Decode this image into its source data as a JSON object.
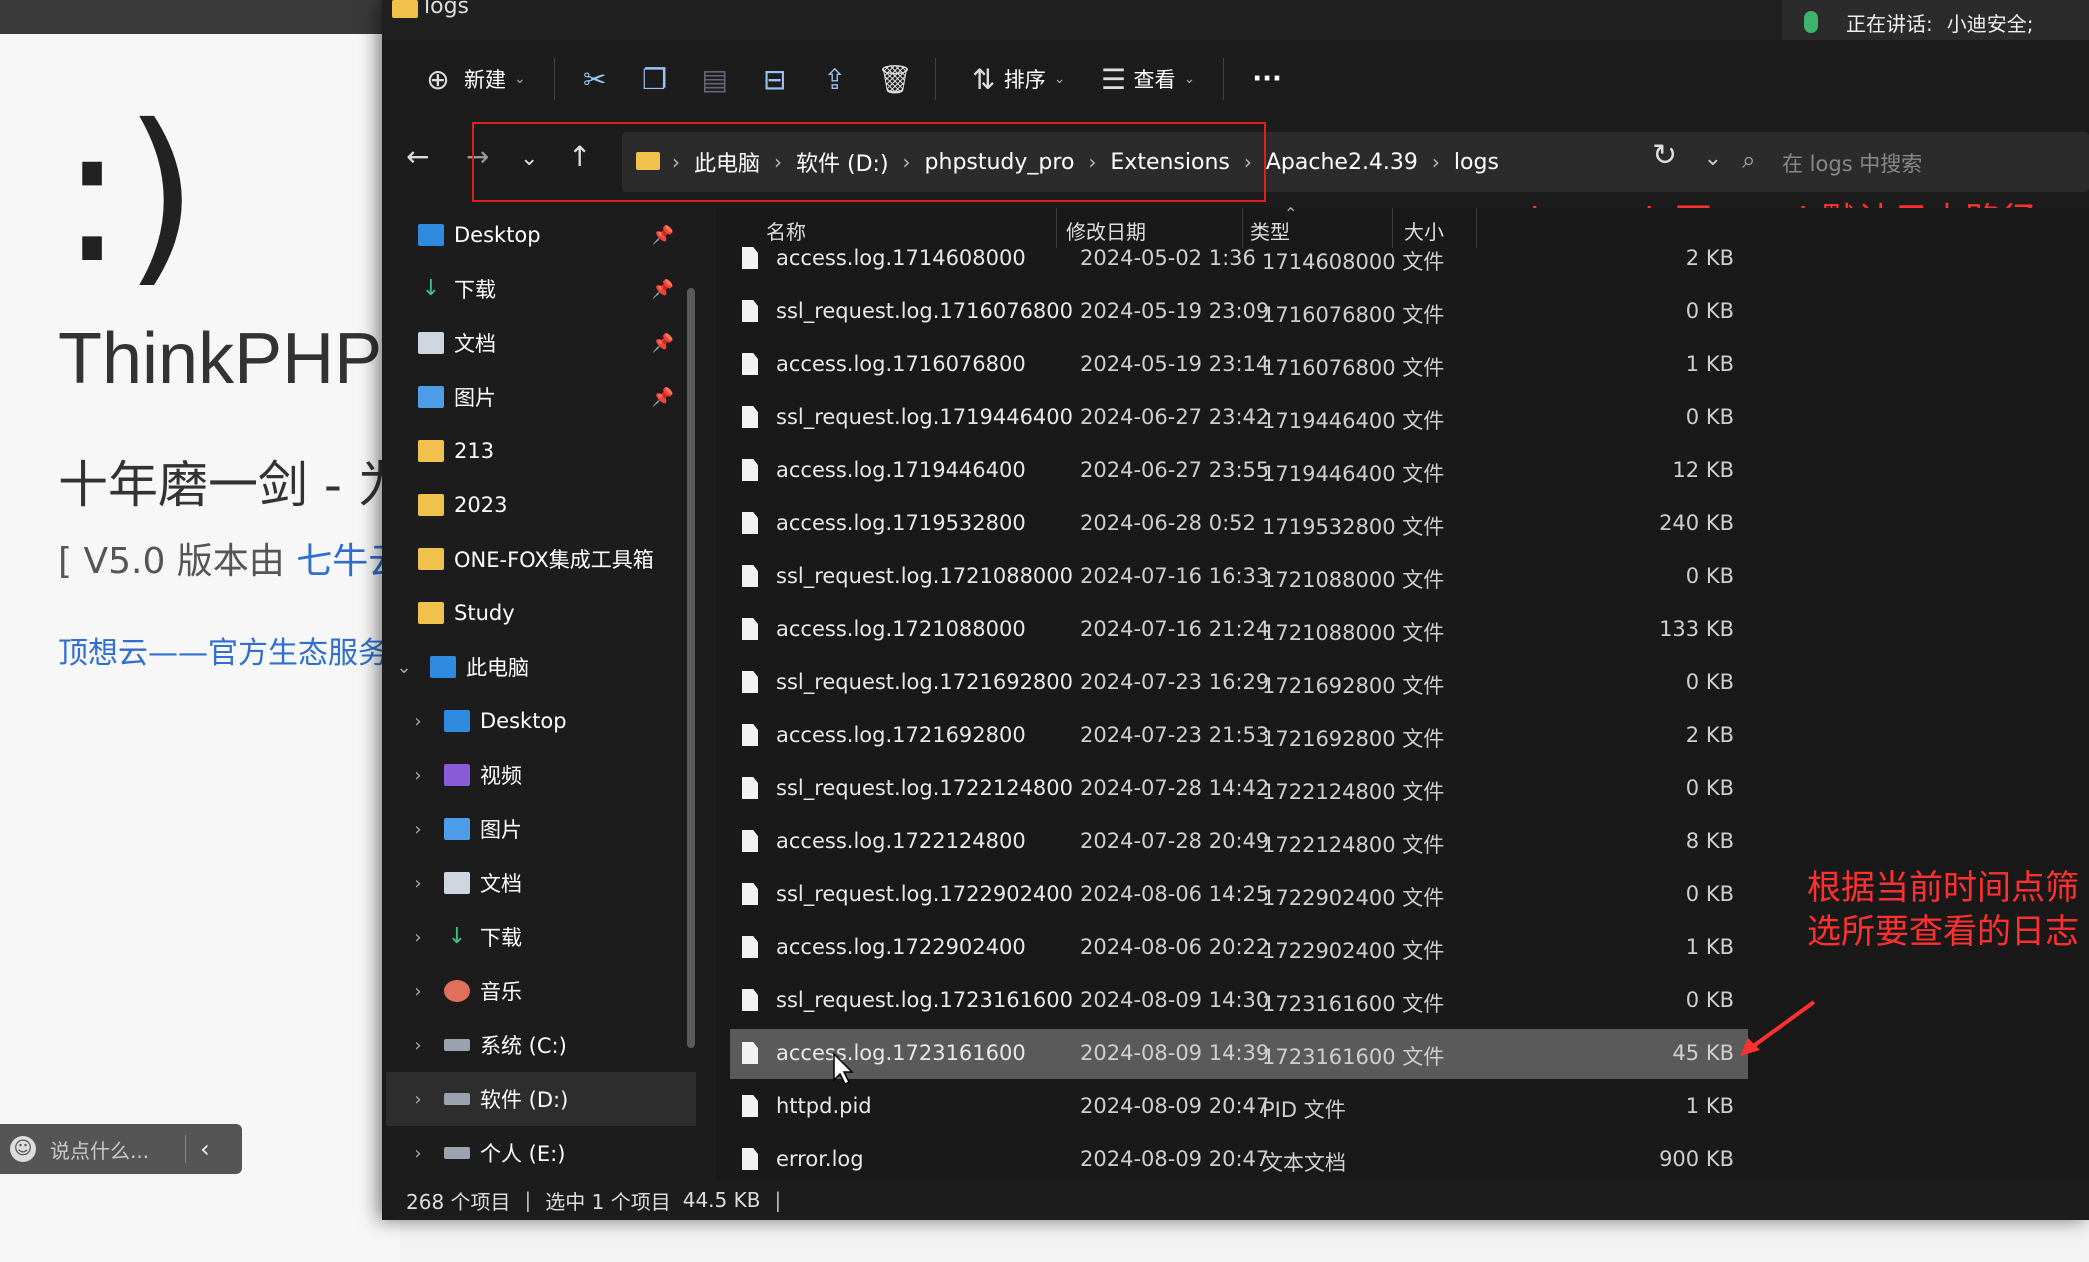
{
  "background": {
    "smiley": ":)",
    "title": "ThinkPHP",
    "slogan": "十年磨一剑 - 为",
    "version_prefix": "[ V5.0 版本由 ",
    "version_link": "七牛云",
    "link_text": "顶想云——官方生态服务",
    "chat_placeholder": "说点什么..."
  },
  "window": {
    "title": "logs",
    "talk_label": "正在讲话:",
    "talk_user": "小迪安全;"
  },
  "toolbar": {
    "new_label": "新建",
    "sort_label": "排序",
    "view_label": "查看",
    "more_label": "···"
  },
  "address": {
    "crumbs": [
      "此电脑",
      "软件 (D:)",
      "phpstudy_pro",
      "Extensions",
      "Apache2.4.39",
      "logs"
    ]
  },
  "search": {
    "placeholder": "在 logs 中搜索"
  },
  "sidebar": {
    "items": [
      {
        "label": "Desktop"
      },
      {
        "label": "下载"
      },
      {
        "label": "文档"
      },
      {
        "label": "图片"
      },
      {
        "label": "213"
      },
      {
        "label": "2023"
      },
      {
        "label": "ONE-FOX集成工具箱"
      },
      {
        "label": "Study"
      },
      {
        "label": "此电脑"
      },
      {
        "label": "Desktop"
      },
      {
        "label": "视频"
      },
      {
        "label": "图片"
      },
      {
        "label": "文档"
      },
      {
        "label": "下载"
      },
      {
        "label": "音乐"
      },
      {
        "label": "系统 (C:)"
      },
      {
        "label": "软件 (D:)"
      },
      {
        "label": "个人 (E:)"
      }
    ]
  },
  "columns": {
    "name": "名称",
    "date": "修改日期",
    "type": "类型",
    "size": "大小"
  },
  "files": [
    {
      "name": "access.log.1714608000",
      "date": "2024-05-02 1:36",
      "type": "1714608000 文件",
      "size": "2 KB"
    },
    {
      "name": "ssl_request.log.1716076800",
      "date": "2024-05-19 23:09",
      "type": "1716076800 文件",
      "size": "0 KB"
    },
    {
      "name": "access.log.1716076800",
      "date": "2024-05-19 23:14",
      "type": "1716076800 文件",
      "size": "1 KB"
    },
    {
      "name": "ssl_request.log.1719446400",
      "date": "2024-06-27 23:42",
      "type": "1719446400 文件",
      "size": "0 KB"
    },
    {
      "name": "access.log.1719446400",
      "date": "2024-06-27 23:55",
      "type": "1719446400 文件",
      "size": "12 KB"
    },
    {
      "name": "access.log.1719532800",
      "date": "2024-06-28 0:52",
      "type": "1719532800 文件",
      "size": "240 KB"
    },
    {
      "name": "ssl_request.log.1721088000",
      "date": "2024-07-16 16:33",
      "type": "1721088000 文件",
      "size": "0 KB"
    },
    {
      "name": "access.log.1721088000",
      "date": "2024-07-16 21:24",
      "type": "1721088000 文件",
      "size": "133 KB"
    },
    {
      "name": "ssl_request.log.1721692800",
      "date": "2024-07-23 16:29",
      "type": "1721692800 文件",
      "size": "0 KB"
    },
    {
      "name": "access.log.1721692800",
      "date": "2024-07-23 21:53",
      "type": "1721692800 文件",
      "size": "2 KB"
    },
    {
      "name": "ssl_request.log.1722124800",
      "date": "2024-07-28 14:42",
      "type": "1722124800 文件",
      "size": "0 KB"
    },
    {
      "name": "access.log.1722124800",
      "date": "2024-07-28 20:49",
      "type": "1722124800 文件",
      "size": "8 KB"
    },
    {
      "name": "ssl_request.log.1722902400",
      "date": "2024-08-06 14:25",
      "type": "1722902400 文件",
      "size": "0 KB"
    },
    {
      "name": "access.log.1722902400",
      "date": "2024-08-06 20:22",
      "type": "1722902400 文件",
      "size": "1 KB"
    },
    {
      "name": "ssl_request.log.1723161600",
      "date": "2024-08-09 14:30",
      "type": "1723161600 文件",
      "size": "0 KB"
    },
    {
      "name": "access.log.1723161600",
      "date": "2024-08-09 14:39",
      "type": "1723161600 文件",
      "size": "45 KB"
    },
    {
      "name": "httpd.pid",
      "date": "2024-08-09 20:47",
      "type": "PID 文件",
      "size": "1 KB"
    },
    {
      "name": "error.log",
      "date": "2024-08-09 20:47",
      "type": "文本文档",
      "size": "900 KB"
    }
  ],
  "status": {
    "count": "268 个项目",
    "selected": "选中 1 个项目",
    "selected_size": "44.5 KB"
  },
  "annotations": {
    "top": "phpstudy下apach默认日志路径",
    "right": "根据当前时间点筛选所要查看的日志",
    "color": "#ff3030"
  }
}
